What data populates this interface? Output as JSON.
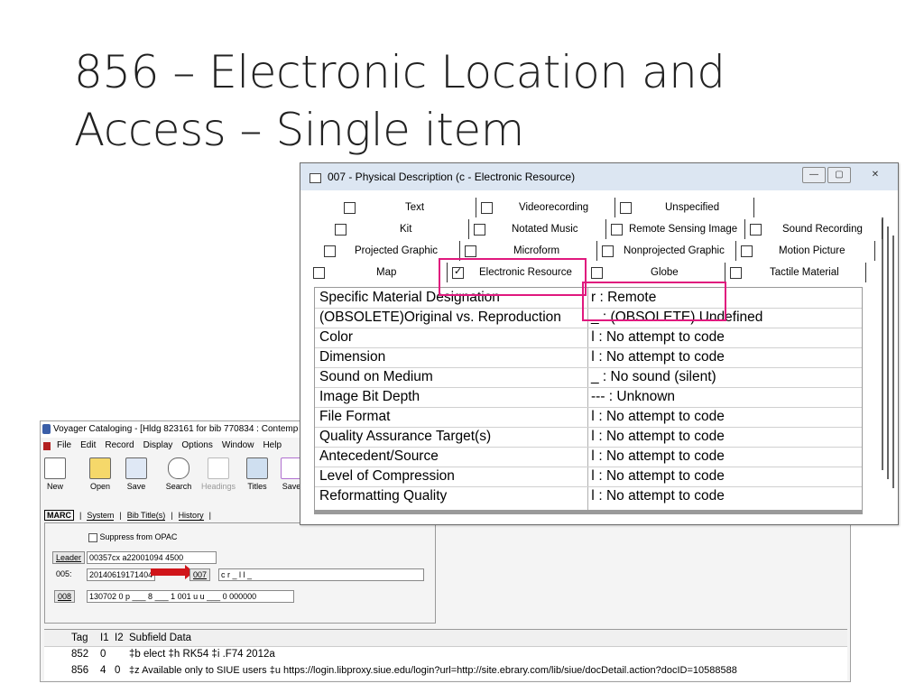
{
  "slide": {
    "title_line1": "856 – Electronic Location and",
    "title_line2": "Access – Single item"
  },
  "voyager": {
    "title": "Voyager Cataloging - [Hldg 823161 for bib 770834 : Contemp",
    "menu": [
      "File",
      "Edit",
      "Record",
      "Display",
      "Options",
      "Window",
      "Help"
    ],
    "toolbar": [
      "New",
      "Open",
      "Save",
      "Search",
      "Headings",
      "Titles",
      "Save"
    ],
    "tabs": [
      "MARC",
      "System",
      "Bib Title(s)",
      "History"
    ],
    "suppress_label": "Suppress from OPAC",
    "leader_label": "Leader",
    "leader_value": "00357cx  a22001094  4500",
    "f005_label": "005:",
    "f005_value": "20140619171404",
    "f007_label": "007",
    "f007_value": "c r _ l l _",
    "f008_label": "008",
    "f008_value": "130702 0 p ___ 8 ___ 1 001 u u ___ 0 000000",
    "grid_headers": [
      "Tag",
      "I1",
      "I2",
      "Subfield Data"
    ],
    "grid_rows": [
      {
        "tag": "852",
        "i1": "0",
        "i2": "",
        "data": "‡b elect ‡h RK54 ‡i .F74 2012a"
      },
      {
        "tag": "856",
        "i1": "4",
        "i2": "0",
        "data": "‡z Available only to SIUE users ‡u https://login.libproxy.siue.edu/login?url=http://site.ebrary.com/lib/siue/docDetail.action?docID=10588588"
      }
    ]
  },
  "dialog": {
    "title": "007 - Physical Description (c - Electronic Resource)",
    "window_buttons": [
      "—",
      "▢",
      "✕"
    ],
    "tabs_row1": [
      "Text",
      "Videorecording",
      "Unspecified"
    ],
    "tabs_row2": [
      "Kit",
      "Notated Music",
      "Remote Sensing Image",
      "Sound Recording"
    ],
    "tabs_row3": [
      "Projected Graphic",
      "Microform",
      "Nonprojected Graphic",
      "Motion Picture"
    ],
    "tabs_row4": [
      "Map",
      "Electronic Resource",
      "Globe",
      "Tactile Material"
    ],
    "checked_tab": "Electronic Resource",
    "rows": [
      {
        "k": "Specific Material Designation",
        "v": "r : Remote"
      },
      {
        "k": "(OBSOLETE)Original vs. Reproduction",
        "v": "_ : (OBSOLETE) Undefined"
      },
      {
        "k": "Color",
        "v": "ǀ : No attempt to code"
      },
      {
        "k": "Dimension",
        "v": "ǀ : No attempt to code"
      },
      {
        "k": "Sound on Medium",
        "v": "_ : No sound (silent)"
      },
      {
        "k": "Image Bit Depth",
        "v": "--- : Unknown"
      },
      {
        "k": "File Format",
        "v": "ǀ : No attempt to code"
      },
      {
        "k": "Quality Assurance Target(s)",
        "v": "ǀ : No attempt to code"
      },
      {
        "k": "Antecedent/Source",
        "v": "ǀ : No attempt to code"
      },
      {
        "k": "Level of Compression",
        "v": "ǀ : No attempt to code"
      },
      {
        "k": "Reformatting Quality",
        "v": "ǀ : No attempt to code"
      }
    ]
  },
  "colors": {
    "highlight": "#e0197e",
    "arrow": "#d0151a",
    "dialog_title_bg": "#dce6f2"
  }
}
